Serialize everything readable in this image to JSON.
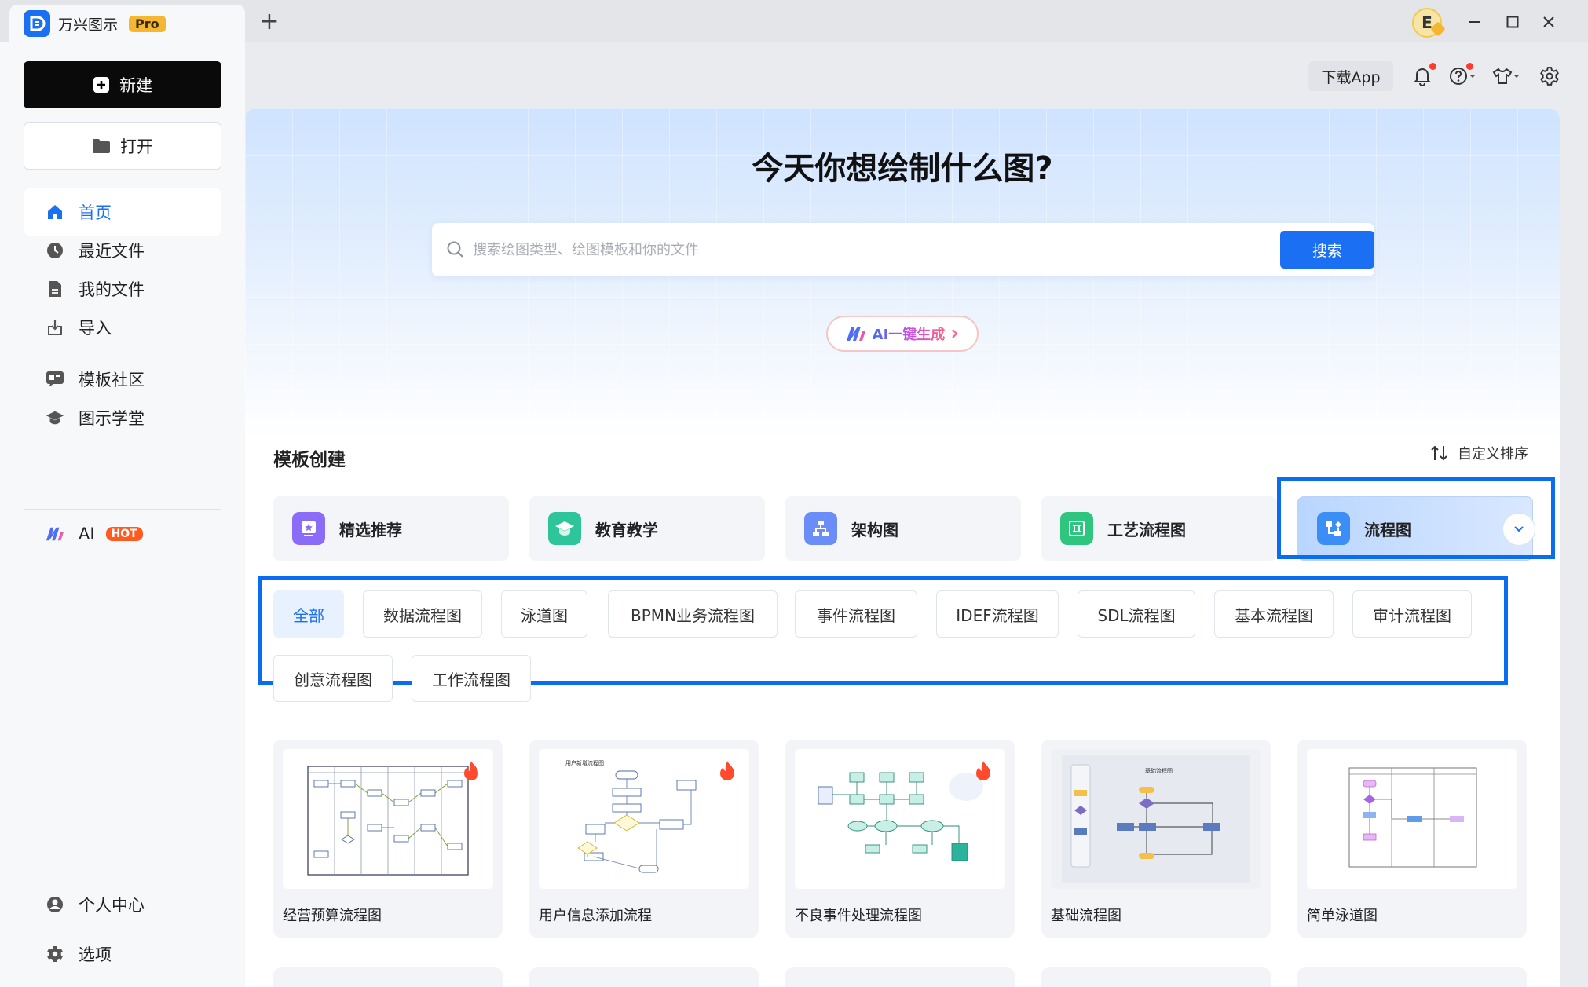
{
  "app": {
    "name": "万兴图示",
    "badge": "Pro",
    "new_tab": "+",
    "avatar_letter": "E"
  },
  "window_controls": {
    "minimize": "—",
    "maximize": "☐",
    "close": "✕"
  },
  "sidebar": {
    "new_label": "新建",
    "open_label": "打开",
    "items": [
      {
        "label": "首页",
        "icon": "home-icon",
        "active": true
      },
      {
        "label": "最近文件",
        "icon": "clock-icon"
      },
      {
        "label": "我的文件",
        "icon": "file-icon"
      },
      {
        "label": "导入",
        "icon": "import-icon"
      },
      {
        "label": "模板社区",
        "icon": "template-community-icon"
      },
      {
        "label": "图示学堂",
        "icon": "graduation-cap-icon"
      },
      {
        "label": "AI",
        "icon": "ai-logo-icon",
        "badge": "HOT"
      }
    ],
    "bottom_items": [
      {
        "label": "个人中心",
        "icon": "user-icon"
      },
      {
        "label": "选项",
        "icon": "gear-icon"
      }
    ]
  },
  "toolbar": {
    "download_app": "下载App"
  },
  "hero": {
    "title": "今天你想绘制什么图?",
    "search_placeholder": "搜索绘图类型、绘图模板和你的文件",
    "search_button": "搜索",
    "ai_generate": "AI一键生成"
  },
  "templates": {
    "section_title": "模板创建",
    "sort_label": "自定义排序",
    "categories": [
      {
        "label": "精选推荐",
        "color": "#8b6cf6"
      },
      {
        "label": "教育教学",
        "color": "#2fc59a"
      },
      {
        "label": "架构图",
        "color": "#6b8df7"
      },
      {
        "label": "工艺流程图",
        "color": "#2ec67f"
      },
      {
        "label": "流程图",
        "color": "#3a8ef5",
        "selected": true
      }
    ],
    "filters": [
      "全部",
      "数据流程图",
      "泳道图",
      "BPMN业务流程图",
      "事件流程图",
      "IDEF流程图",
      "SDL流程图",
      "基本流程图",
      "审计流程图",
      "创意流程图",
      "工作流程图"
    ],
    "active_filter": "全部",
    "cards": [
      {
        "title": "经营预算流程图",
        "hot": true
      },
      {
        "title": "用户信息添加流程",
        "hot": true,
        "thumb_heading": "用户新增流程图"
      },
      {
        "title": "不良事件处理流程图",
        "hot": true
      },
      {
        "title": "基础流程图",
        "hot": false,
        "thumb_heading": "基础流程图"
      },
      {
        "title": "简单泳道图",
        "hot": false
      }
    ]
  },
  "colors": {
    "accent": "#1b6ff2",
    "highlight_border": "#0a6cf0",
    "hot": "#ff5a1f"
  }
}
